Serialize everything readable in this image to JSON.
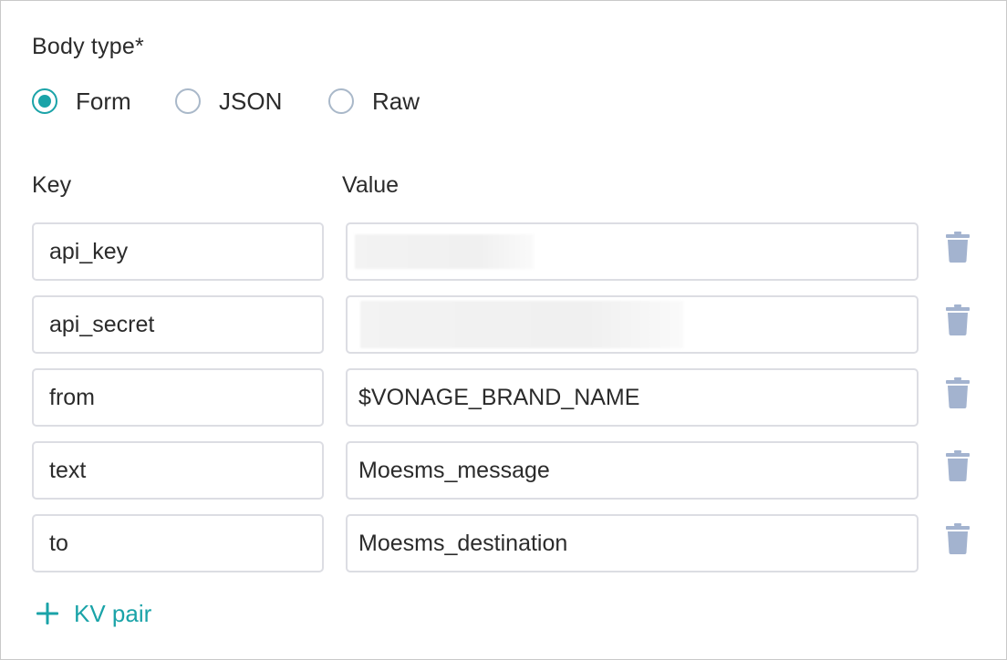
{
  "body_type": {
    "label": "Body type*",
    "options": [
      {
        "label": "Form",
        "checked": true
      },
      {
        "label": "JSON",
        "checked": false
      },
      {
        "label": "Raw",
        "checked": false
      }
    ]
  },
  "columns": {
    "key": "Key",
    "value": "Value"
  },
  "rows": [
    {
      "key": "api_key",
      "value": "",
      "value_redacted": true
    },
    {
      "key": "api_secret",
      "value": "",
      "value_redacted": true
    },
    {
      "key": "from",
      "value": "$VONAGE_BRAND_NAME",
      "value_redacted": false
    },
    {
      "key": "text",
      "value": "Moesms_message",
      "value_redacted": false
    },
    {
      "key": "to",
      "value": "Moesms_destination",
      "value_redacted": false
    }
  ],
  "add_button": {
    "label": "KV pair",
    "icon": "plus-icon"
  },
  "icons": {
    "delete": "trash-icon"
  },
  "colors": {
    "accent": "#1aa3a8",
    "radio_unchecked_border": "#a9b8c9",
    "field_border": "#dcdde3",
    "trash": "#a3b3cf",
    "panel_border": "#c9c9c9"
  }
}
